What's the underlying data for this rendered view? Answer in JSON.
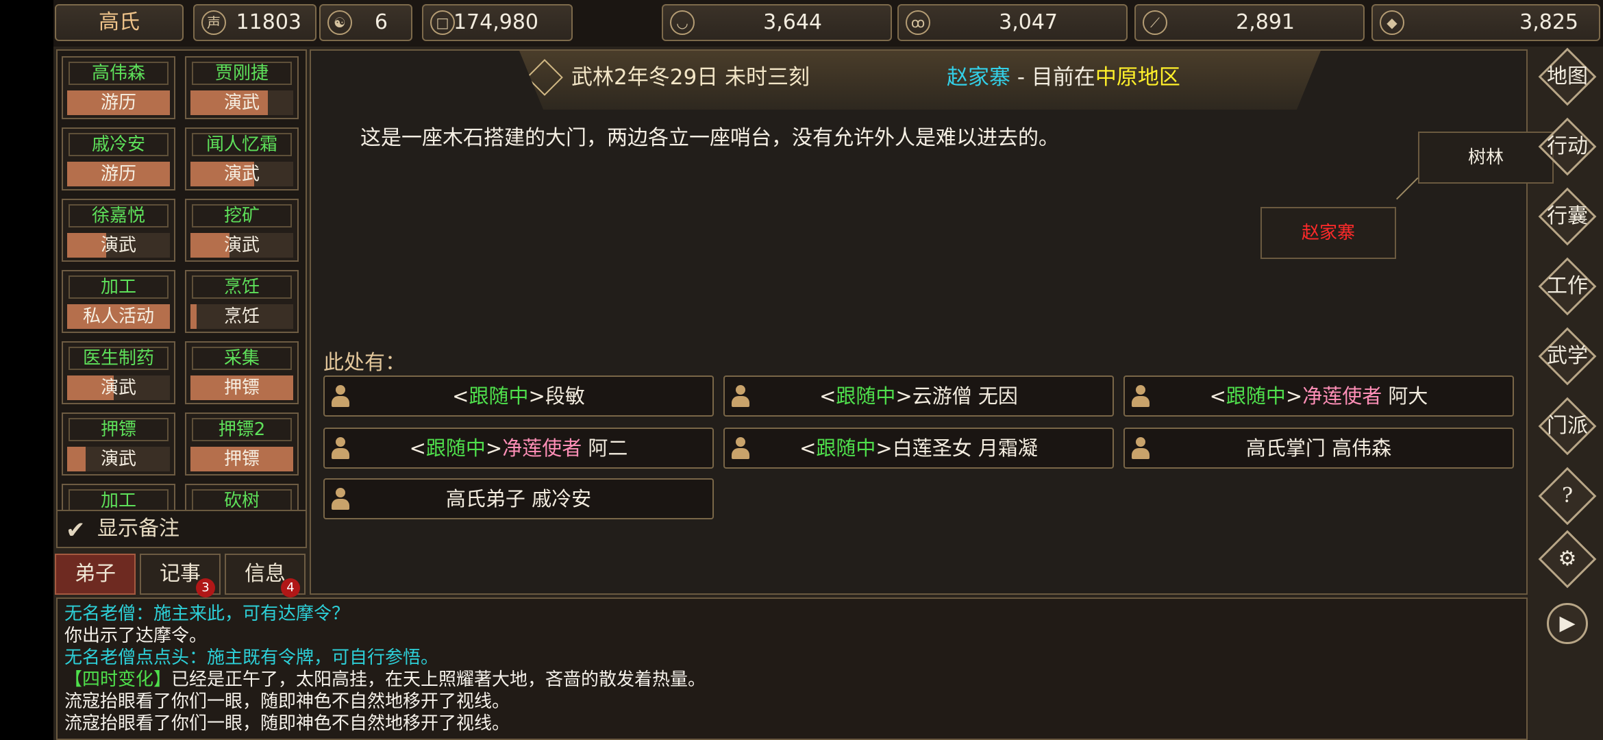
{
  "top_bar": {
    "clan_name": "高氏",
    "resources": [
      {
        "icon": "reputation-icon",
        "icon_glyph": "声",
        "value": "11803"
      },
      {
        "icon": "taiji-icon",
        "icon_glyph": "☯",
        "value": "6"
      },
      {
        "icon": "coin-icon",
        "icon_glyph": "□",
        "value": "174,980"
      },
      {
        "icon": "food-bowl-icon",
        "icon_glyph": "◡",
        "value": "3,644"
      },
      {
        "icon": "gourd-icon",
        "icon_glyph": "ꝏ",
        "value": "3,047"
      },
      {
        "icon": "wood-log-icon",
        "icon_glyph": "⟋",
        "value": "2,891"
      },
      {
        "icon": "ore-icon",
        "icon_glyph": "◆",
        "value": "3,825"
      }
    ]
  },
  "disciples": [
    {
      "name": "高伟森",
      "activity": "游历",
      "progress": 1.0
    },
    {
      "name": "贾刚捷",
      "activity": "演武",
      "progress": 0.75
    },
    {
      "name": "戚冷安",
      "activity": "游历",
      "progress": 1.0
    },
    {
      "name": "闻人忆霜",
      "activity": "演武",
      "progress": 0.62
    },
    {
      "name": "徐嘉悦",
      "activity": "演武",
      "progress": 0.38
    },
    {
      "name": "挖矿",
      "activity": "演武",
      "progress": 0.38
    },
    {
      "name": "加工",
      "activity": "私人活动",
      "progress": 1.0
    },
    {
      "name": "烹饪",
      "activity": "烹饪",
      "progress": 0.06
    },
    {
      "name": "医生制药",
      "activity": "演武",
      "progress": 0.45
    },
    {
      "name": "采集",
      "activity": "押镖",
      "progress": 1.0
    },
    {
      "name": "押镖",
      "activity": "演武",
      "progress": 0.18
    },
    {
      "name": "押镖2",
      "activity": "押镖",
      "progress": 1.0
    },
    {
      "name": "加工",
      "activity": "",
      "progress": 0
    },
    {
      "name": "砍树",
      "activity": "",
      "progress": 0
    }
  ],
  "show_notes_label": "显示备注",
  "tabs": [
    {
      "label": "弟子",
      "badge": ""
    },
    {
      "label": "记事",
      "badge": "3"
    },
    {
      "label": "信息",
      "badge": "4"
    }
  ],
  "header": {
    "date": "武林2年冬29日 未时三刻",
    "place": "赵家寨",
    "separator": " - ",
    "location_prefix": "目前在",
    "region": "中原地区"
  },
  "description": "这是一座木石搭建的大门，两边各立一座哨台，没有允许外人是难以进去的。",
  "map": {
    "neighbor": "树林",
    "current": "赵家寨"
  },
  "here_label": "此处有：",
  "npcs": [
    {
      "open": "<",
      "tag": "跟随中",
      "close": ">",
      "title": "",
      "name": "段敏"
    },
    {
      "open": "<",
      "tag": "跟随中",
      "close": ">",
      "title": "",
      "name": "云游僧 无因"
    },
    {
      "open": "<",
      "tag": "跟随中",
      "close": ">",
      "title": "净莲使者",
      "name": " 阿大"
    },
    {
      "open": "<",
      "tag": "跟随中",
      "close": ">",
      "title": "净莲使者",
      "name": " 阿二"
    },
    {
      "open": "<",
      "tag": "跟随中",
      "close": ">",
      "title": "",
      "name": "白莲圣女 月霜凝"
    },
    {
      "open": "",
      "tag": "",
      "close": "",
      "title": "",
      "name": "高氏掌门 高伟森"
    },
    {
      "open": "",
      "tag": "",
      "close": "",
      "title": "",
      "name": "高氏弟子 戚冷安"
    }
  ],
  "right_menu": [
    {
      "label": "地图",
      "icon": "map-icon"
    },
    {
      "label": "行动",
      "icon": "action-icon"
    },
    {
      "label": "行囊",
      "icon": "bag-icon"
    },
    {
      "label": "工作",
      "icon": "work-icon"
    },
    {
      "label": "武学",
      "icon": "martial-icon"
    },
    {
      "label": "门派",
      "icon": "sect-icon"
    },
    {
      "label": "?",
      "icon": "help-icon"
    },
    {
      "label": "⚙",
      "icon": "gear-icon"
    },
    {
      "label": "▶",
      "icon": "play-icon"
    }
  ],
  "log": [
    {
      "parts": [
        {
          "text": "无名老僧：施主来此，可有达摩令？",
          "color": "cyan"
        }
      ]
    },
    {
      "parts": [
        {
          "text": "你出示了达摩令。",
          "color": "white"
        }
      ]
    },
    {
      "parts": [
        {
          "text": "无名老僧点点头：施主既有令牌，可自行参悟。",
          "color": "cyan"
        }
      ]
    },
    {
      "parts": [
        {
          "text": "【四时变化】",
          "color": "green"
        },
        {
          "text": "已经是正午了，太阳高挂，在天上照耀著大地，吝啬的散发着热量。",
          "color": "white"
        }
      ]
    },
    {
      "parts": [
        {
          "text": "流寇抬眼看了你们一眼，随即神色不自然地移开了视线。",
          "color": "white"
        }
      ]
    },
    {
      "parts": [
        {
          "text": "流寇抬眼看了你们一眼，随即神色不自然地移开了视线。",
          "color": "white"
        }
      ]
    }
  ],
  "colors": {
    "follow_tag": "#4fe04c",
    "title_pink": "#ff8fb7",
    "place_cyan": "#33d0e8",
    "region_yellow": "#fff02a",
    "current_map_red": "#ff2a2a"
  }
}
